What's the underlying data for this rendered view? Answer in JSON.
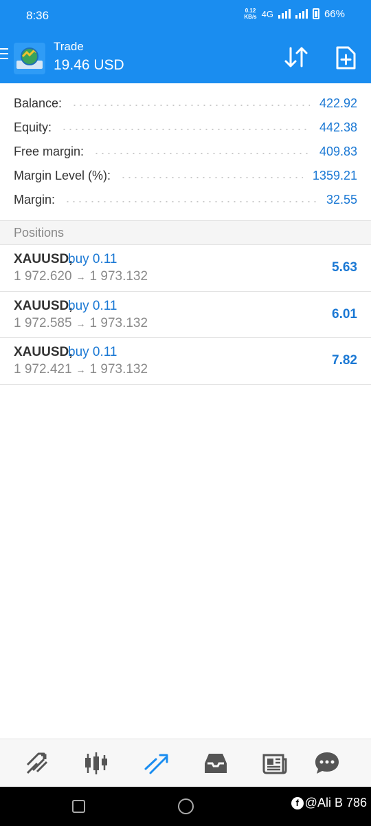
{
  "status_bar": {
    "time": "8:36",
    "net_speed_value": "0.12",
    "net_speed_unit": "KB/s",
    "network": "4G",
    "battery": "66%"
  },
  "header": {
    "title": "Trade",
    "subtitle": "19.46 USD"
  },
  "summary": [
    {
      "label": "Balance:",
      "value": "422.92"
    },
    {
      "label": "Equity:",
      "value": "442.38"
    },
    {
      "label": "Free margin:",
      "value": "409.83"
    },
    {
      "label": "Margin Level (%):",
      "value": "1359.21"
    },
    {
      "label": "Margin:",
      "value": "32.55"
    }
  ],
  "positions": {
    "header": "Positions",
    "items": [
      {
        "symbol": "XAUUSD,",
        "direction": "buy 0.11",
        "open_price": "1 972.620",
        "arrow": "→",
        "current_price": "1 973.132",
        "profit": "5.63"
      },
      {
        "symbol": "XAUUSD,",
        "direction": "buy 0.11",
        "open_price": "1 972.585",
        "arrow": "→",
        "current_price": "1 973.132",
        "profit": "6.01"
      },
      {
        "symbol": "XAUUSD,",
        "direction": "buy 0.11",
        "open_price": "1 972.421",
        "arrow": "→",
        "current_price": "1 973.132",
        "profit": "7.82"
      }
    ]
  },
  "bottom_nav": [
    {
      "icon": "quotes-icon"
    },
    {
      "icon": "chart-icon"
    },
    {
      "icon": "trade-icon",
      "active": true
    },
    {
      "icon": "history-icon"
    },
    {
      "icon": "news-icon"
    },
    {
      "icon": "messages-icon"
    }
  ],
  "watermark": "@Ali B 786",
  "colors": {
    "primary": "#1a8df0",
    "value_blue": "#1a78d4",
    "nav_icon": "#555555"
  }
}
